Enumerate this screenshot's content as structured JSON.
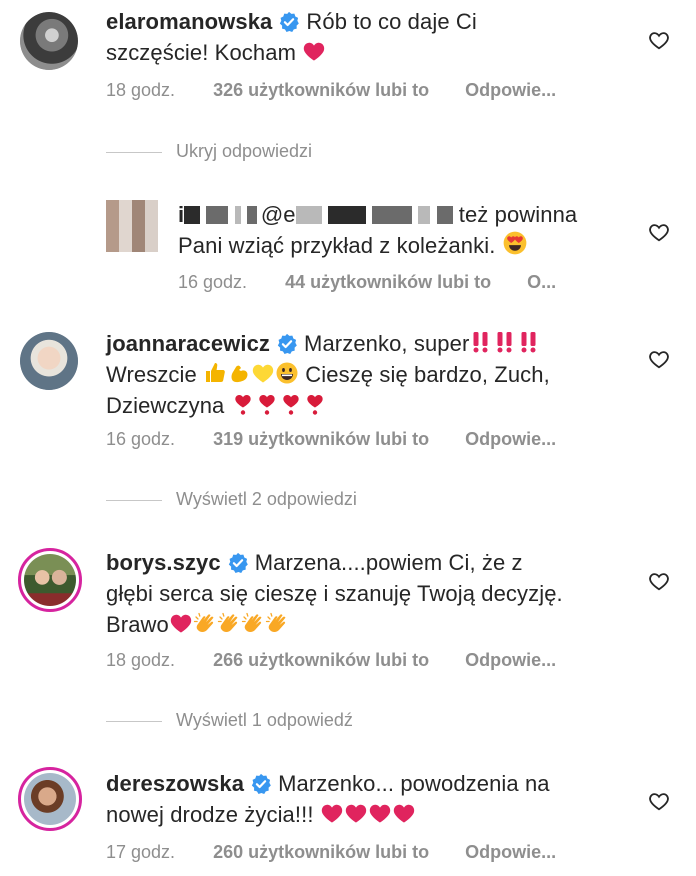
{
  "comments": [
    {
      "username": "elaromanowska",
      "text1": "Rób to co daje Ci",
      "text2": "szczęście!  Kocham",
      "time": "18 godz.",
      "likes": "326 użytkowników lubi to",
      "reply": "Odpowie..."
    },
    {
      "username_start": "i",
      "mention_start": "@e",
      "text1": "też powinna",
      "text2": "Pani wziąć przykład z koleżanki.",
      "time": "16 godz.",
      "likes": "44 użytkowników lubi to",
      "reply": "O..."
    },
    {
      "username": "joannaracewicz",
      "text1": "Marzenko, super",
      "text2": "Wreszcie",
      "text2b": "Cieszę się bardzo, Zuch,",
      "text3": "Dziewczyna",
      "time": "16 godz.",
      "likes": "319 użytkowników lubi to",
      "reply": "Odpowie..."
    },
    {
      "username": "borys.szyc",
      "text1": "Marzena....powiem Ci, że z",
      "text2": "głębi serca się cieszę i szanuję Twoją decyzję.",
      "text3": "Brawo",
      "time": "18 godz.",
      "likes": "266 użytkowników lubi to",
      "reply": "Odpowie..."
    },
    {
      "username": "dereszowska",
      "text1": "Marzenko... powodzenia na",
      "text2": "nowej drodze życia!!!",
      "time": "17 godz.",
      "likes": "260 użytkowników lubi to",
      "reply": "Odpowie..."
    }
  ],
  "toggles": {
    "hide_replies": "Ukryj odpowiedzi",
    "view_2": "Wyświetl 2 odpowiedzi",
    "view_1": "Wyświetl 1 odpowiedź"
  },
  "icons": {
    "verified": "verified-badge-icon",
    "like": "heart-outline-icon"
  },
  "colors": {
    "verified": "#3897f0",
    "muted": "#8e8e8e",
    "heart_red": "#e0245e",
    "story_ring": "#d6249f"
  }
}
